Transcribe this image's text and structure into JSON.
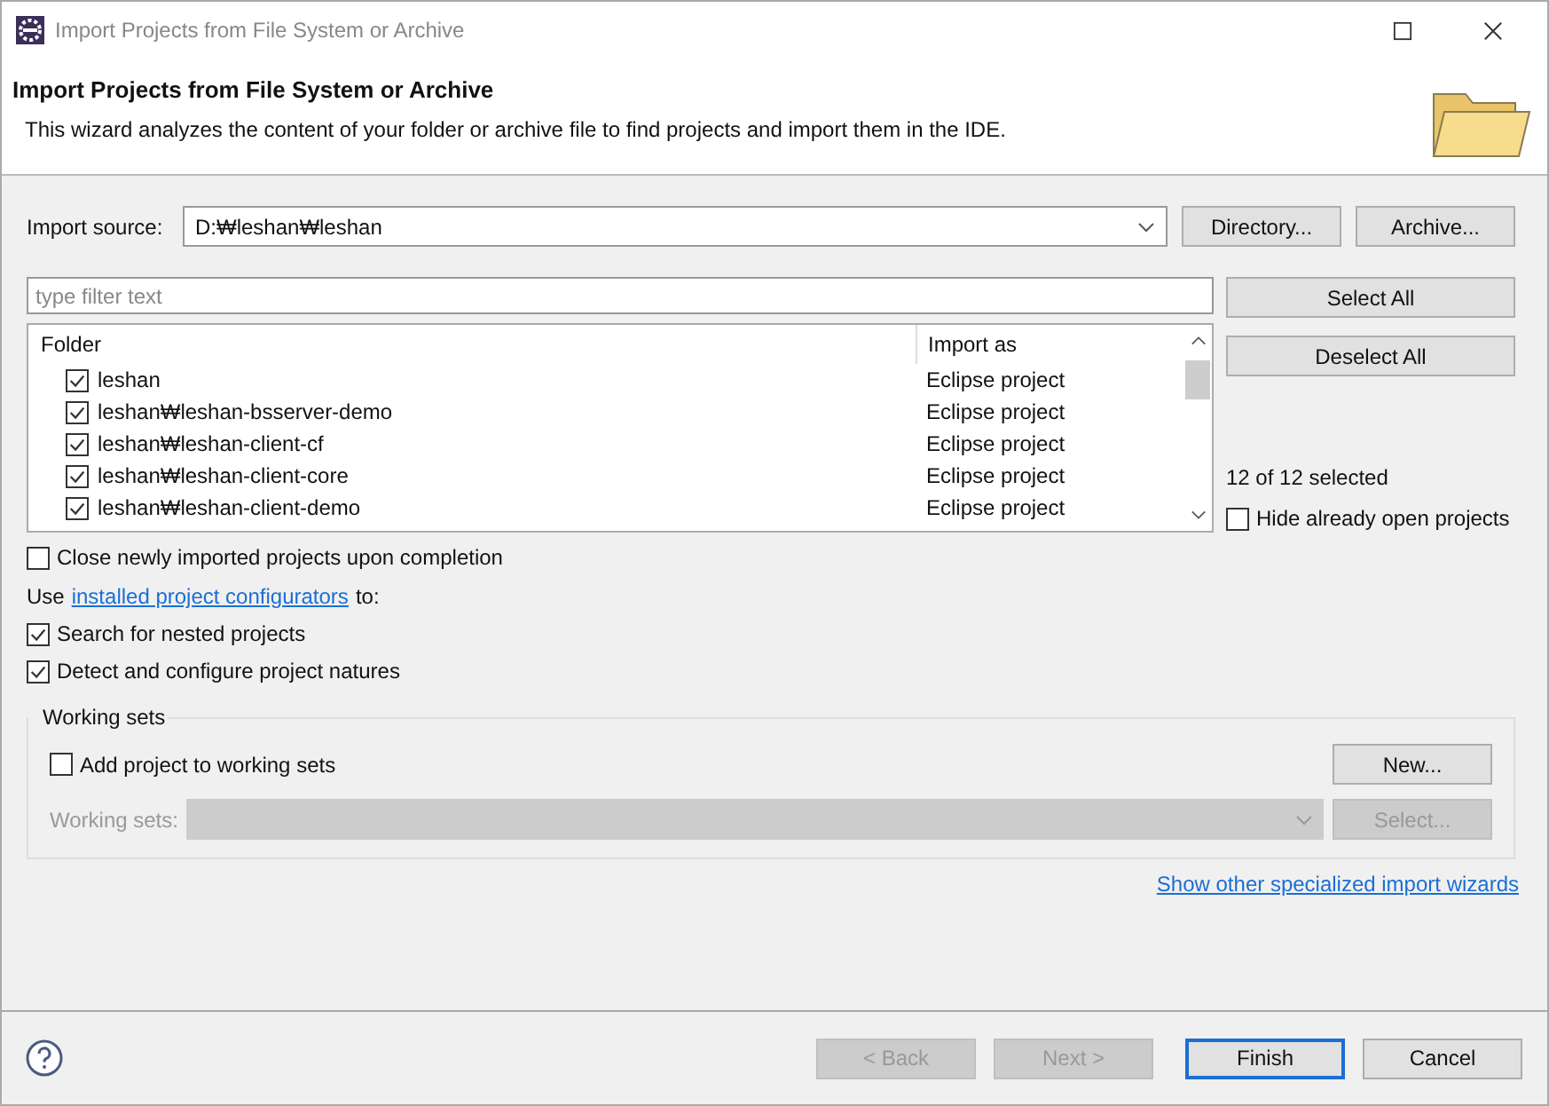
{
  "window": {
    "title": "Import Projects from File System or Archive"
  },
  "header": {
    "title": "Import Projects from File System or Archive",
    "description": "This wizard analyzes the content of your folder or archive file to find projects and import them in the IDE."
  },
  "import_source": {
    "label": "Import source:",
    "value": "D:₩leshan₩leshan",
    "buttons": [
      "Directory...",
      "Archive..."
    ]
  },
  "filter": {
    "placeholder": "type filter text"
  },
  "table": {
    "columns": [
      "Folder",
      "Import as"
    ],
    "rows": [
      {
        "folder": "leshan",
        "import_as": "Eclipse project",
        "checked": true
      },
      {
        "folder": "leshan₩leshan-bsserver-demo",
        "import_as": "Eclipse project",
        "checked": true
      },
      {
        "folder": "leshan₩leshan-client-cf",
        "import_as": "Eclipse project",
        "checked": true
      },
      {
        "folder": "leshan₩leshan-client-core",
        "import_as": "Eclipse project",
        "checked": true
      },
      {
        "folder": "leshan₩leshan-client-demo",
        "import_as": "Eclipse project",
        "checked": true
      }
    ]
  },
  "side_buttons": [
    "Select All",
    "Deselect All"
  ],
  "selection_count": "12 of 12 selected",
  "hide_open": {
    "label": "Hide already open projects",
    "checked": false
  },
  "close_option": {
    "label": "Close newly imported projects upon completion",
    "checked": false
  },
  "configurators": {
    "before": "Use",
    "link": "installed project configurators",
    "after": "to:"
  },
  "options": [
    {
      "label": "Search for nested projects",
      "checked": true
    },
    {
      "label": "Detect and configure project natures",
      "checked": true
    }
  ],
  "working_sets": {
    "legend": "Working sets",
    "add": {
      "label": "Add project to working sets",
      "checked": false
    },
    "new_button": "New...",
    "sets_label": "Working sets:",
    "select_button": "Select...",
    "disabled": true
  },
  "other_wizards_link": "Show other specialized import wizards",
  "footer_buttons": [
    {
      "label": "< Back",
      "disabled": true,
      "default": false
    },
    {
      "label": "Next >",
      "disabled": true,
      "default": false
    },
    {
      "label": "Finish",
      "disabled": false,
      "default": true
    },
    {
      "label": "Cancel",
      "disabled": false,
      "default": false
    }
  ]
}
